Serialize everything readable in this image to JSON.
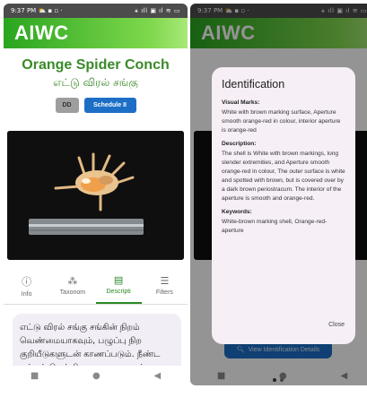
{
  "left_screen": {
    "status": {
      "time": "9:37 PM",
      "icons": "⛅ ▪ ▫ ·",
      "right": "⚹ ıll ▣ ıl ≋ ▭"
    },
    "app_title": "AIWC",
    "species_name": "Orange Spider Conch",
    "species_tamil": "எட்டு விரல் சங்கு",
    "badges": {
      "dd": "DD",
      "schedule": "Schedule II"
    },
    "tabs": [
      {
        "label": "Info",
        "icon": "info-circle-icon"
      },
      {
        "label": "Taxonom",
        "icon": "taxonomy-icon"
      },
      {
        "label": "Descripti",
        "icon": "document-icon"
      },
      {
        "label": "Filters",
        "icon": "filter-lines-icon"
      }
    ],
    "description_tamil": "எட்டு விரல் சங்கு சங்கின் நிறம் வெண்மையாகவும், பழுப்பு நிற குறியீடுகளுடன் காணப்படும். நீண்ட மற்றும் மெல்லிய முனைகளுடன், மிருதுவான"
  },
  "right_screen": {
    "status": {
      "time": "9:37 PM",
      "icons": "⛅ ▪ ▫ ·",
      "right": "⚹ ıll ▣ ıl ≋ ▭"
    },
    "app_title": "AIWC",
    "background_button": "View Identification Details",
    "dialog": {
      "title": "Identification",
      "visual_marks_label": "Visual Marks:",
      "visual_marks_text": "White with brown marking surface, Aperture smooth orange-red in colour, interior aperture is orange-red",
      "description_label": "Description:",
      "description_text": "The shell is White with brown markings, long slender extremities, and Aperture smooth orange-red in colour, The outer surface is white and spotted with brown, but is covered over by a dark brown periostracum. The interior of the aperture is smooth and orange-red.",
      "keywords_label": "Keywords:",
      "keywords_text": "White-brown marking shell, Orange-red-aperture",
      "close_label": "Close"
    }
  },
  "colors": {
    "appbar_gradient_start": "#2aa51f",
    "appbar_gradient_end": "#a9e879",
    "species_green": "#3b8a2a",
    "schedule_blue": "#1d6fc6",
    "dd_grey": "#9e9e9e",
    "dialog_bg": "#f6eff6",
    "desc_card_bg": "#f1eef6"
  },
  "navbar": {
    "square": "■",
    "circle": "●",
    "back": "◀"
  }
}
